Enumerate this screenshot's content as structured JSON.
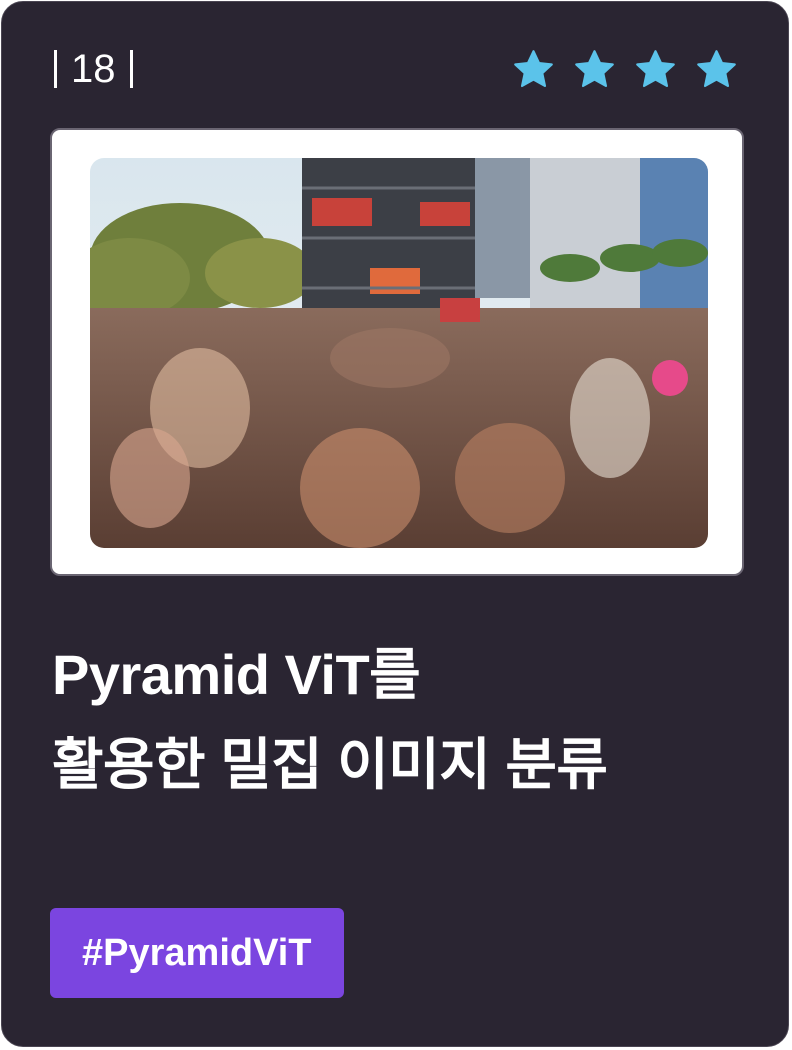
{
  "card": {
    "number": "18",
    "rating": {
      "value": 4,
      "max": 4,
      "icon": "star-icon",
      "color": "#5bc3ea"
    },
    "image": {
      "subject": "crowd-photo"
    },
    "title_line1": "Pyramid ViT를",
    "title_line2": "활용한 밀집 이미지 분류",
    "tag": "#PyramidViT",
    "colors": {
      "background": "#2a2532",
      "tag": "#7b45e0",
      "text": "#ffffff"
    }
  }
}
